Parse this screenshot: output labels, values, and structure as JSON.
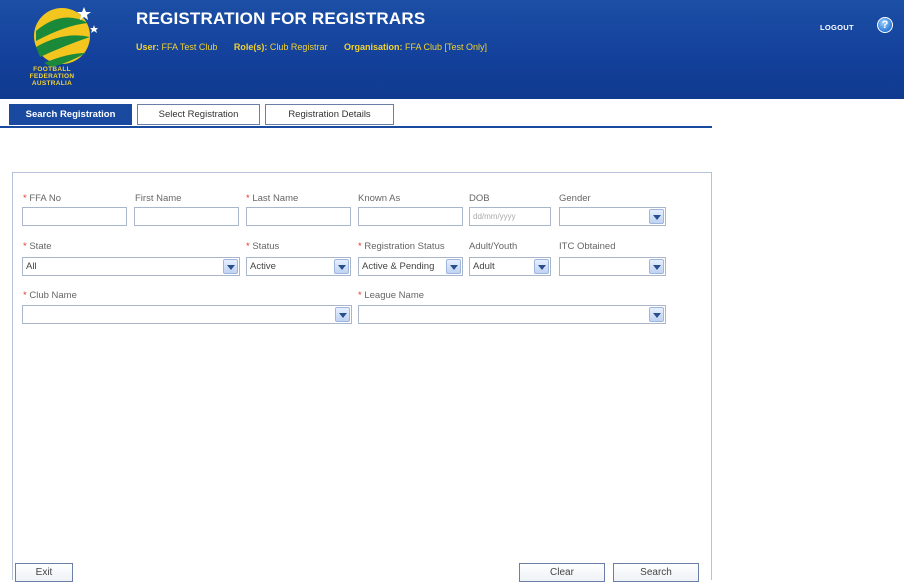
{
  "header": {
    "title": "REGISTRATION FOR REGISTRARS",
    "user_label": "User:",
    "user_value": "FFA Test Club",
    "roles_label": "Role(s):",
    "roles_value": "Club Registrar",
    "org_label": "Organisation:",
    "org_value": "FFA Club [Test Only]",
    "logout": "LOGOUT",
    "help": "?",
    "logo_lines": [
      "FOOTBALL",
      "FEDERATION",
      "AUSTRALIA"
    ]
  },
  "tabs": [
    {
      "label": "Search Registration",
      "active": true
    },
    {
      "label": "Select Registration",
      "active": false
    },
    {
      "label": "Registration Details",
      "active": false
    }
  ],
  "form": {
    "ffa_no": {
      "label": "FFA No",
      "required": true,
      "value": ""
    },
    "first_name": {
      "label": "First Name",
      "required": false,
      "value": ""
    },
    "last_name": {
      "label": "Last Name",
      "required": true,
      "value": ""
    },
    "known_as": {
      "label": "Known As",
      "required": false,
      "value": ""
    },
    "dob": {
      "label": "DOB",
      "required": false,
      "placeholder": "dd/mm/yyyy"
    },
    "gender": {
      "label": "Gender",
      "required": false,
      "value": ""
    },
    "state": {
      "label": "State",
      "required": true,
      "value": "All"
    },
    "status": {
      "label": "Status",
      "required": true,
      "value": "Active"
    },
    "registration_status": {
      "label": "Registration Status",
      "required": true,
      "value": "Active & Pending"
    },
    "adult_youth": {
      "label": "Adult/Youth",
      "required": false,
      "value": "Adult"
    },
    "itc_obtained": {
      "label": "ITC Obtained",
      "required": false,
      "value": ""
    },
    "club_name": {
      "label": "Club Name",
      "required": true,
      "value": ""
    },
    "league_name": {
      "label": "League Name",
      "required": true,
      "value": ""
    }
  },
  "buttons": {
    "exit": "Exit",
    "clear": "Clear",
    "search": "Search"
  },
  "colors": {
    "header_blue": "#1c4fa6",
    "accent_yellow": "#f2d230",
    "required_red": "#e0392c"
  }
}
